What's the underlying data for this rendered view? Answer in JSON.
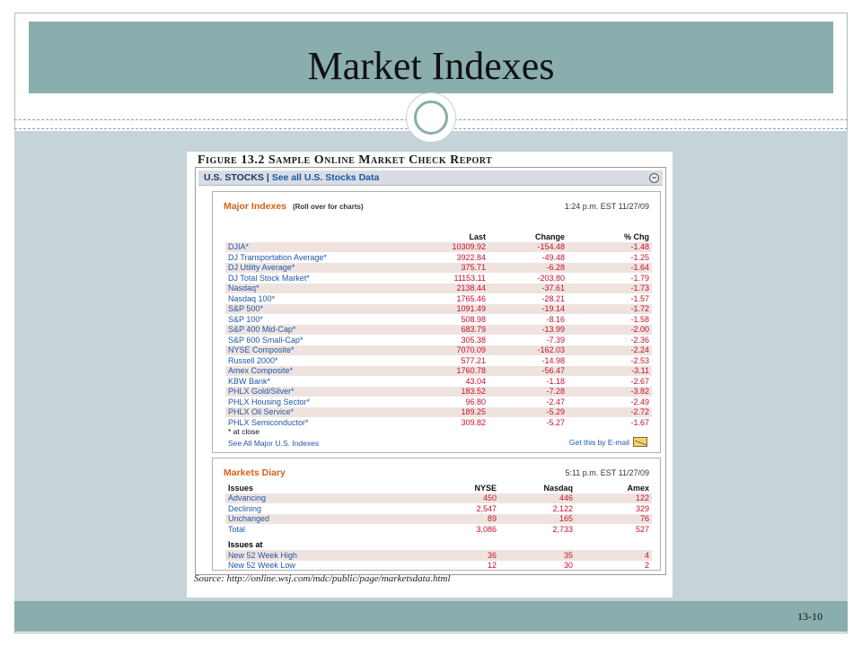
{
  "slide": {
    "title": "Market Indexes",
    "number": "13-10"
  },
  "figure": {
    "title": "Figure 13.2 Sample Online Market Check Report",
    "header_label": "U.S. STOCKS |",
    "header_link": "See all U.S. Stocks Data",
    "minimize_symbol": "−",
    "indexes": {
      "title": "Major Indexes",
      "hint": "(Roll over for charts)",
      "time": "1:24 p.m. EST 11/27/09",
      "columns": [
        "",
        "Last",
        "Change",
        "% Chg"
      ],
      "rows": [
        [
          "DJIA*",
          "10309.92",
          "-154.48",
          "-1.48"
        ],
        [
          "DJ Transportation Average*",
          "3922.84",
          "-49.48",
          "-1.25"
        ],
        [
          "DJ Utility Average*",
          "375.71",
          "-6.28",
          "-1.64"
        ],
        [
          "DJ Total Stock Market*",
          "11153.11",
          "-203.80",
          "-1.79"
        ],
        [
          "Nasdaq*",
          "2138.44",
          "-37.61",
          "-1.73"
        ],
        [
          "Nasdaq 100*",
          "1765.46",
          "-28.21",
          "-1.57"
        ],
        [
          "S&P 500*",
          "1091.49",
          "-19.14",
          "-1.72"
        ],
        [
          "S&P 100*",
          "508.98",
          "-8.16",
          "-1.58"
        ],
        [
          "S&P 400 Mid-Cap*",
          "683.79",
          "-13.99",
          "-2.00"
        ],
        [
          "S&P 600 Small-Cap*",
          "305.38",
          "-7.39",
          "-2.36"
        ],
        [
          "NYSE Composite*",
          "7070.09",
          "-162.03",
          "-2.24"
        ],
        [
          "Russell 2000*",
          "577.21",
          "-14.98",
          "-2.53"
        ],
        [
          "Amex Composite*",
          "1760.78",
          "-56.47",
          "-3.11"
        ],
        [
          "KBW Bank*",
          "43.04",
          "-1.18",
          "-2.67"
        ],
        [
          "PHLX Gold/Silver*",
          "183.52",
          "-7.28",
          "-3.82"
        ],
        [
          "PHLX Housing Sector*",
          "96.80",
          "-2.47",
          "-2.49"
        ],
        [
          "PHLX Oil Service*",
          "189.25",
          "-5.29",
          "-2.72"
        ],
        [
          "PHLX Semiconductor*",
          "309.82",
          "-5.27",
          "-1.67"
        ]
      ],
      "note": "* at close",
      "see_all": "See All Major U.S. Indexes",
      "email": "Get this by E-mail"
    },
    "diary": {
      "title": "Markets Diary",
      "time": "5:11 p.m. EST 11/27/09",
      "columns": [
        "Issues",
        "NYSE",
        "Nasdaq",
        "Amex"
      ],
      "rows": [
        [
          "Advancing",
          "450",
          "446",
          "122"
        ],
        [
          "Declining",
          "2,547",
          "2,122",
          "329"
        ],
        [
          "Unchanged",
          "89",
          "165",
          "76"
        ],
        [
          "Total",
          "3,086",
          "2,733",
          "527"
        ]
      ],
      "subheader": "Issues at",
      "rows2": [
        [
          "New 52 Week High",
          "36",
          "35",
          "4"
        ],
        [
          "New 52 Week Low",
          "12",
          "30",
          "2"
        ]
      ]
    },
    "source": "Source: http://online.wsj.com/mdc/public/page/marketsdata.html"
  },
  "colors": {
    "title_bar": "#8aadad",
    "content_bg": "#c6d3d8",
    "index_orange": "#d4621d",
    "value_red": "#c8102e",
    "link_blue": "#1e58a8"
  }
}
